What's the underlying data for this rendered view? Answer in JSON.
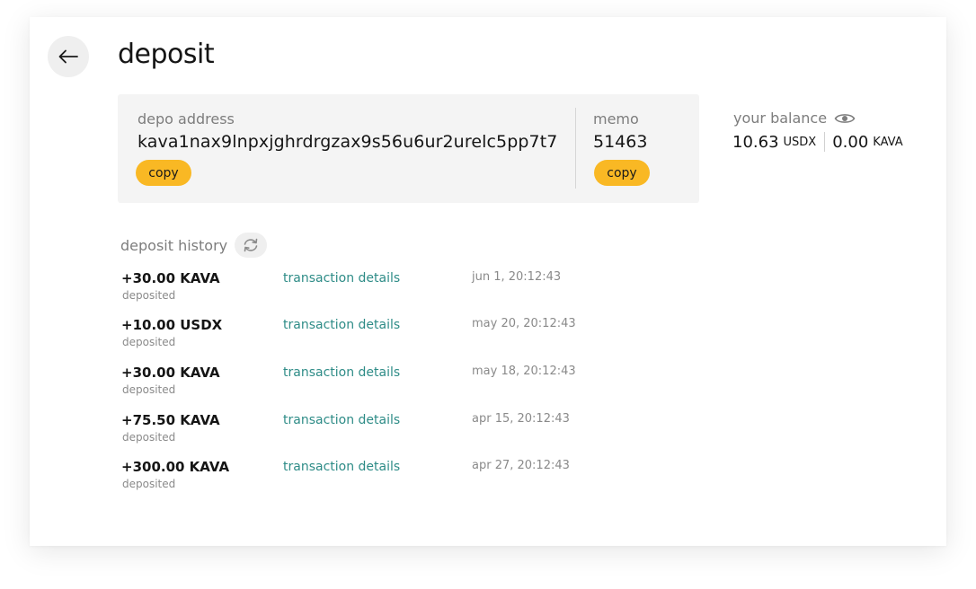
{
  "page": {
    "title": "deposit",
    "back_icon": "arrow-left-icon"
  },
  "deposit_address": {
    "label": "depo address",
    "value": "kava1nax9lnpxjghrdrgzax9s56u6ur2urelc5pp7t7",
    "copy_label": "copy"
  },
  "memo": {
    "label": "memo",
    "value": "51463",
    "copy_label": "copy"
  },
  "balance": {
    "label": "your balance",
    "visibility_icon": "eye-icon",
    "usdx_amount": "10.63",
    "usdx_unit": "USDX",
    "kava_amount": "0.00",
    "kava_unit": "KAVA"
  },
  "history": {
    "title": "deposit history",
    "refresh_icon": "refresh-icon",
    "rows": [
      {
        "amount": "+30.00 KAVA",
        "status": "deposited",
        "link": "transaction details",
        "date": "jun 1, 20:12:43"
      },
      {
        "amount": "+10.00 USDX",
        "status": "deposited",
        "link": "transaction details",
        "date": "may 20, 20:12:43"
      },
      {
        "amount": "+30.00 KAVA",
        "status": "deposited",
        "link": "transaction details",
        "date": "may 18, 20:12:43"
      },
      {
        "amount": "+75.50 KAVA",
        "status": "deposited",
        "link": "transaction details",
        "date": "apr 15, 20:12:43"
      },
      {
        "amount": "+300.00 KAVA",
        "status": "deposited",
        "link": "transaction details",
        "date": "apr 27, 20:12:43"
      }
    ]
  },
  "colors": {
    "accent_pill": "#f9b824",
    "link": "#2e8c87",
    "panel_bg": "#f4f4f4"
  }
}
